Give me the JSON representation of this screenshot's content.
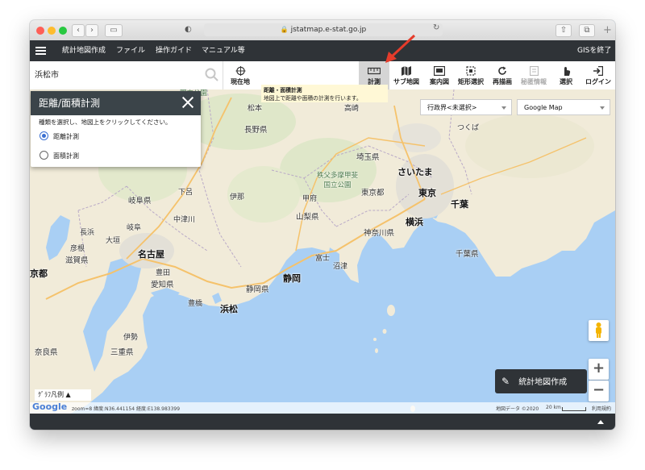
{
  "browser": {
    "url": "jstatmap.e-stat.go.jp"
  },
  "menu": {
    "items": [
      "統計地図作成",
      "ファイル",
      "操作ガイド",
      "マニュアル等"
    ],
    "exit": "GISを終了"
  },
  "search": {
    "value": "浜松市"
  },
  "toolbar": {
    "current_location": "現在地",
    "tools": [
      {
        "label": "計測",
        "icon": "ruler-icon",
        "state": "active"
      },
      {
        "label": "サブ地図",
        "icon": "map-icon",
        "state": "normal"
      },
      {
        "label": "案内図",
        "icon": "guide-map-icon",
        "state": "normal"
      },
      {
        "label": "矩形選択",
        "icon": "rectangle-select-icon",
        "state": "normal"
      },
      {
        "label": "再描画",
        "icon": "refresh-icon",
        "state": "normal"
      },
      {
        "label": "秘匿情報",
        "icon": "confidential-icon",
        "state": "disabled"
      },
      {
        "label": "選択",
        "icon": "pointer-icon",
        "state": "normal"
      },
      {
        "label": "ログイン",
        "icon": "login-icon",
        "state": "normal"
      }
    ]
  },
  "tooltip": {
    "title": "距離・面積計測",
    "text": "地図上で距離や面積の計測を行います。"
  },
  "panel": {
    "title": "距離/面積計測",
    "instruction": "種類を選択し、地図上をクリックしてください。",
    "options": [
      {
        "label": "距離計測",
        "selected": true
      },
      {
        "label": "面積計測",
        "selected": false
      }
    ]
  },
  "selects": {
    "admin_boundary": "行政界<未選択>",
    "base_map": "Google Map"
  },
  "map_labels": {
    "major_cities": [
      "名古屋",
      "浜松",
      "静岡",
      "東京",
      "横浜",
      "さいたま",
      "京都",
      "千葉"
    ],
    "prefectures": [
      "長野県",
      "山梨県",
      "静岡県",
      "神奈川県",
      "埼玉県",
      "東京都",
      "千葉県",
      "岐阜県",
      "愛知県",
      "三重県",
      "奈良県",
      "滋賀県"
    ],
    "towns": [
      "松本",
      "高崎",
      "つくば",
      "甲府",
      "中津川",
      "豊田",
      "岐阜",
      "長浜",
      "彦根",
      "豊橋",
      "伊勢",
      "富士",
      "沼津",
      "下呂",
      "大垣",
      "伊那"
    ],
    "parks": [
      "国立公園",
      "秩父多摩甲斐\n国立公園"
    ]
  },
  "buttons": {
    "stat_map": "統計地図作成",
    "zoom_in": "+",
    "zoom_out": "−",
    "legend": "ｸﾞﾗﾌ凡例 ▲"
  },
  "footer": {
    "logo": "Google",
    "status": "zoom=8   緯度:N36.441154   経度:E138.983399",
    "map_data": "地図データ ©2020",
    "scale": "20 km",
    "terms": "利用規約"
  },
  "colors": {
    "dark_bar": "#2f3337",
    "sea": "#a9cff4",
    "land": "#f1ebd9",
    "radio_accent": "#3a6fd1",
    "annotation_arrow": "#e53c2b"
  }
}
